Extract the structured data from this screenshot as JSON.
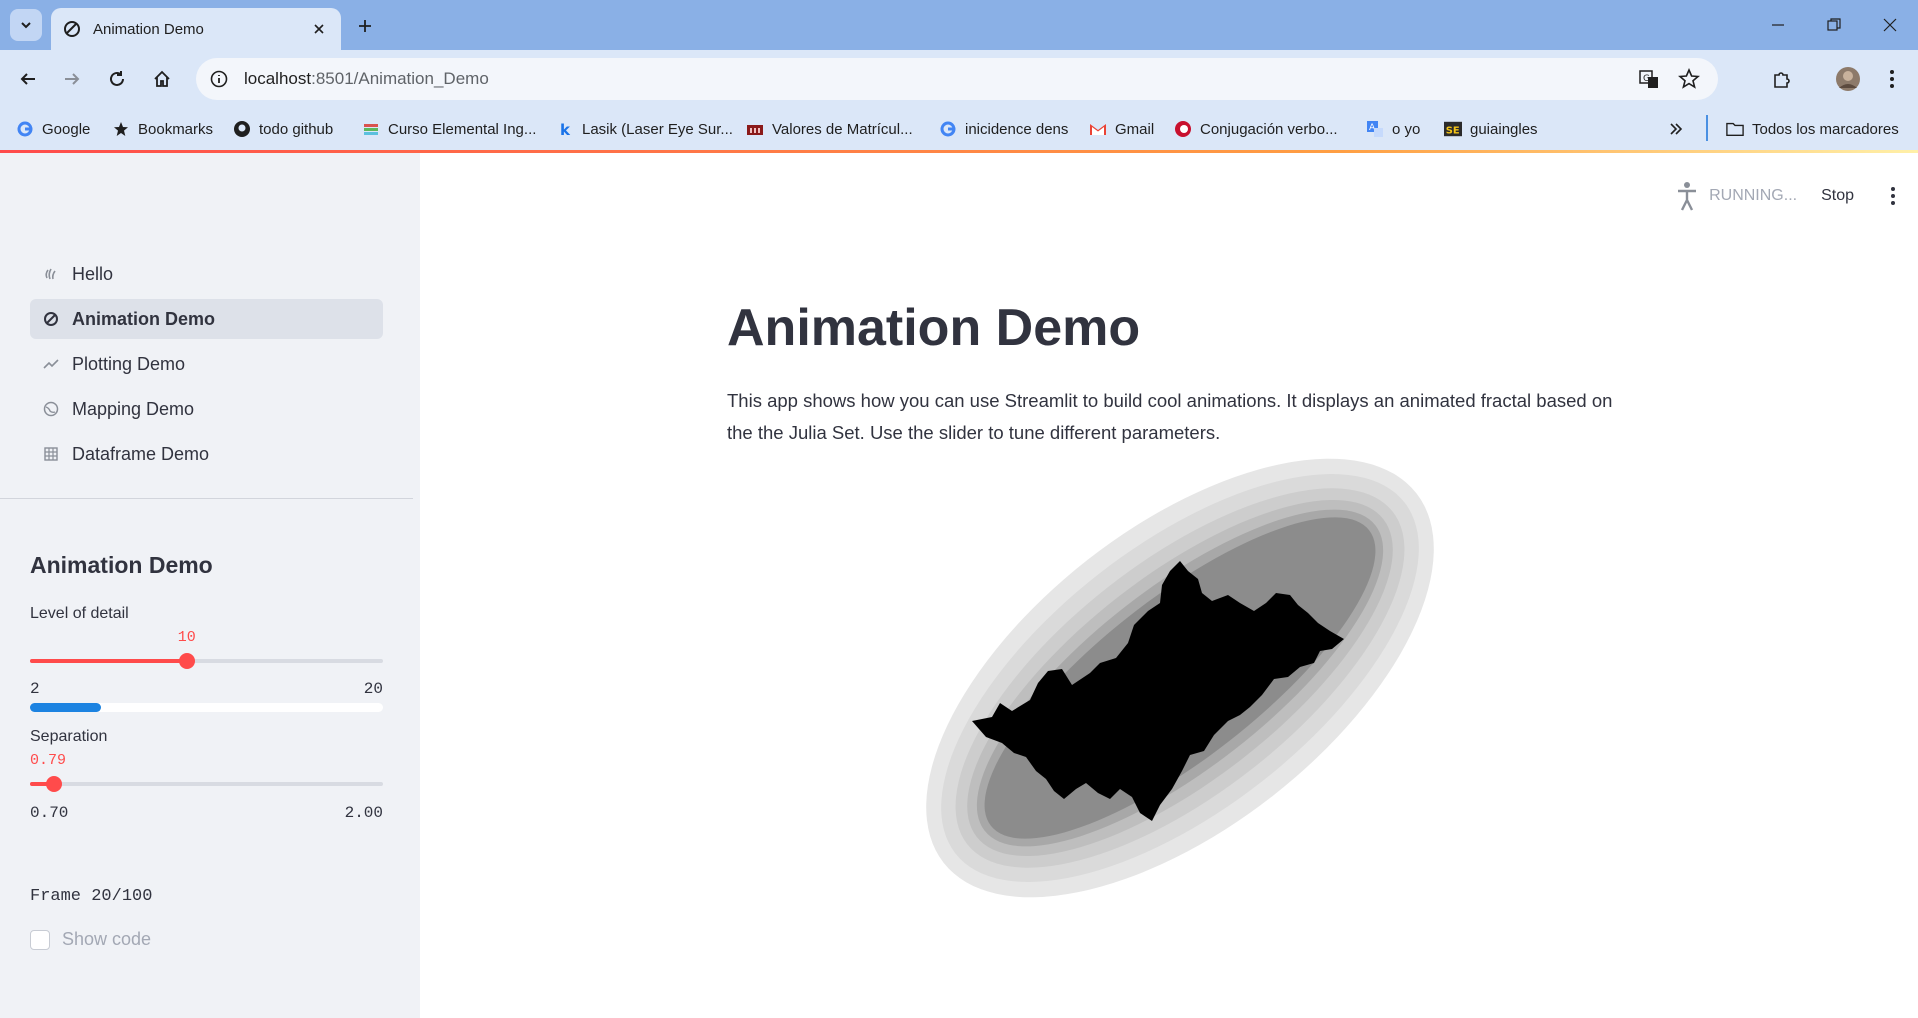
{
  "browser": {
    "tab_title": "Animation Demo",
    "url_host": "localhost",
    "url_path": ":8501/Animation_Demo",
    "bookmarks": [
      {
        "label": "Google",
        "icon": "google-icon"
      },
      {
        "label": "Bookmarks",
        "icon": "star-icon"
      },
      {
        "label": "todo github",
        "icon": "github-icon"
      },
      {
        "label": "Curso Elemental Ing...",
        "icon": "books-icon"
      },
      {
        "label": "Lasik (Laser Eye Sur...",
        "icon": "k-icon"
      },
      {
        "label": "Valores de Matrícul...",
        "icon": "building-icon"
      },
      {
        "label": "inicidence dens",
        "icon": "google-icon"
      },
      {
        "label": "Gmail",
        "icon": "gmail-icon"
      },
      {
        "label": "Conjugación verbo...",
        "icon": "conjugation-icon"
      },
      {
        "label": "o yo",
        "icon": "translate-icon"
      },
      {
        "label": "guiaingles",
        "icon": "se-icon"
      }
    ],
    "all_bookmarks_label": "Todos los marcadores"
  },
  "sidebar": {
    "nav": [
      {
        "label": "Hello",
        "icon": "wave-icon",
        "active": false
      },
      {
        "label": "Animation Demo",
        "icon": "animation-icon",
        "active": true
      },
      {
        "label": "Plotting Demo",
        "icon": "chart-line-icon",
        "active": false
      },
      {
        "label": "Mapping Demo",
        "icon": "globe-icon",
        "active": false
      },
      {
        "label": "Dataframe Demo",
        "icon": "table-icon",
        "active": false
      }
    ],
    "section_title": "Animation Demo",
    "level_of_detail": {
      "label": "Level of detail",
      "value": "10",
      "min": "2",
      "max": "20",
      "fraction": 0.444
    },
    "separation": {
      "label": "Separation",
      "value": "0.79",
      "min": "0.70",
      "max": "2.00",
      "fraction": 0.069
    },
    "progress": 0.2,
    "frame_text": "Frame 20/100",
    "show_code_label": "Show code"
  },
  "header": {
    "running_label": "RUNNING...",
    "stop_label": "Stop"
  },
  "main": {
    "title": "Animation Demo",
    "description": "This app shows how you can use Streamlit to build cool animations. It displays an animated fractal based on the the Julia Set. Use the slider to tune different parameters."
  },
  "colors": {
    "accent": "#ff4b4b",
    "progress": "#1c83e1",
    "sidebar_bg": "#f0f2f6"
  }
}
